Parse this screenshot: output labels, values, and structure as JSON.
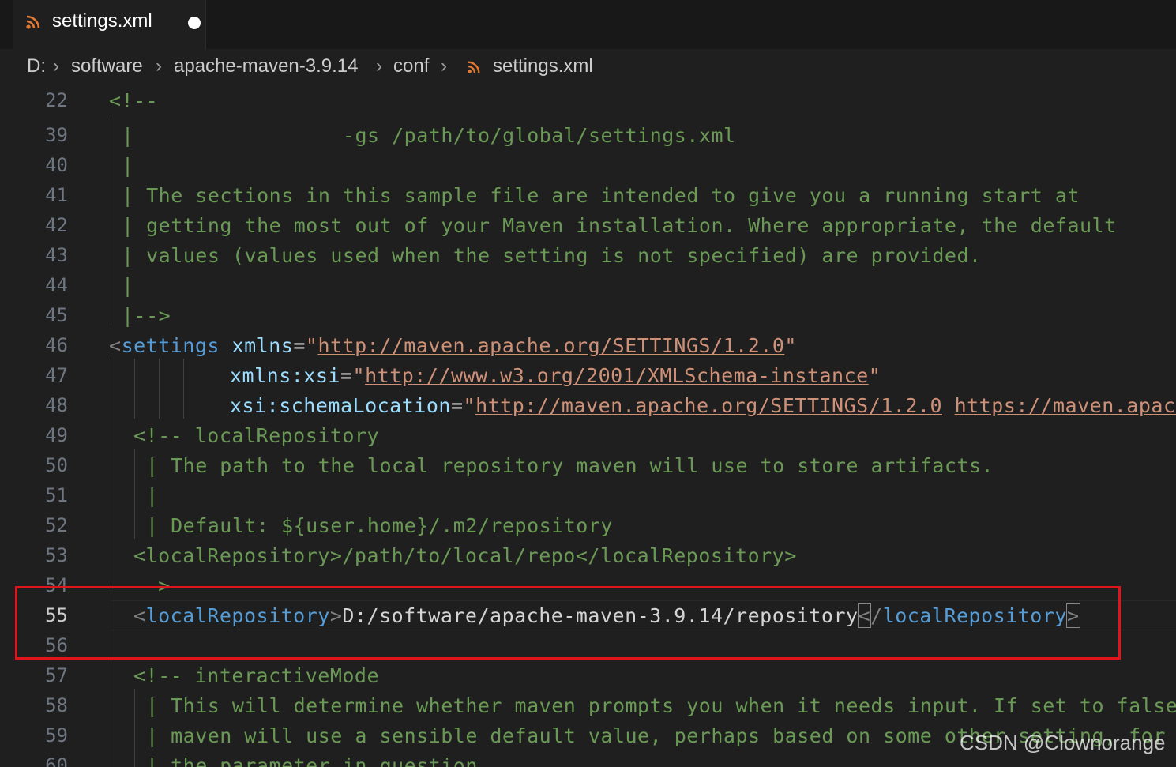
{
  "tab": {
    "filename": "settings.xml",
    "icon": "rss-icon",
    "modified": true
  },
  "breadcrumb": {
    "items": [
      "D:",
      "software",
      "apache-maven-3.9.14",
      "conf",
      "settings.xml"
    ]
  },
  "lines": {
    "l22": {
      "num": "22",
      "text": "<!--"
    },
    "l39": {
      "num": "39",
      "text": "|                 -gs /path/to/global/settings.xml"
    },
    "l40": {
      "num": "40",
      "text": "|"
    },
    "l41": {
      "num": "41",
      "text": "| The sections in this sample file are intended to give you a running start at"
    },
    "l42": {
      "num": "42",
      "text": "| getting the most out of your Maven installation. Where appropriate, the default"
    },
    "l43": {
      "num": "43",
      "text": "| values (values used when the setting is not specified) are provided."
    },
    "l44": {
      "num": "44",
      "text": "|"
    },
    "l45": {
      "num": "45",
      "text": "|-->"
    },
    "l46": {
      "num": "46",
      "tag_open": "<",
      "tag": "settings",
      "attr": "xmlns",
      "eq": "=",
      "q": "\"",
      "url": "http://maven.apache.org/SETTINGS/1.2.0"
    },
    "l47": {
      "num": "47",
      "attr": "xmlns:xsi",
      "eq": "=",
      "q": "\"",
      "url": "http://www.w3.org/2001/XMLSchema-instance"
    },
    "l48": {
      "num": "48",
      "attr": "xsi:schemaLocation",
      "eq": "=",
      "q": "\"",
      "url1": "http://maven.apache.org/SETTINGS/1.2.0",
      "url2": "https://maven.apach"
    },
    "l49": {
      "num": "49",
      "text": "<!-- localRepository"
    },
    "l50": {
      "num": "50",
      "text": "| The path to the local repository maven will use to store artifacts."
    },
    "l51": {
      "num": "51",
      "text": "|"
    },
    "l52": {
      "num": "52",
      "text": "| Default: ${user.home}/.m2/repository"
    },
    "l53": {
      "num": "53",
      "text": "<localRepository>/path/to/local/repo</localRepository>"
    },
    "l54": {
      "num": "54",
      "text": "-->"
    },
    "l55": {
      "num": "55",
      "lt": "<",
      "tag": "localRepository",
      "gt": ">",
      "value": "D:/software/apache-maven-3.9.14/repository",
      "close_lt": "<",
      "close_slash": "/",
      "close_tag": "localRepository",
      "close_gt": ">"
    },
    "l56": {
      "num": "56"
    },
    "l57": {
      "num": "57",
      "text": "<!-- interactiveMode"
    },
    "l58": {
      "num": "58",
      "text": "| This will determine whether maven prompts you when it needs input. If set to false,"
    },
    "l59": {
      "num": "59",
      "text": "| maven will use a sensible default value, perhaps based on some other setting, for"
    },
    "l60": {
      "num": "60",
      "text": "| the parameter in question."
    }
  },
  "watermark": "CSDN @Clownorange",
  "colors": {
    "highlight_border": "#e0151c",
    "comment": "#6a9955",
    "tag": "#569cd6",
    "attr": "#9cdcfe",
    "string": "#ce9178"
  }
}
